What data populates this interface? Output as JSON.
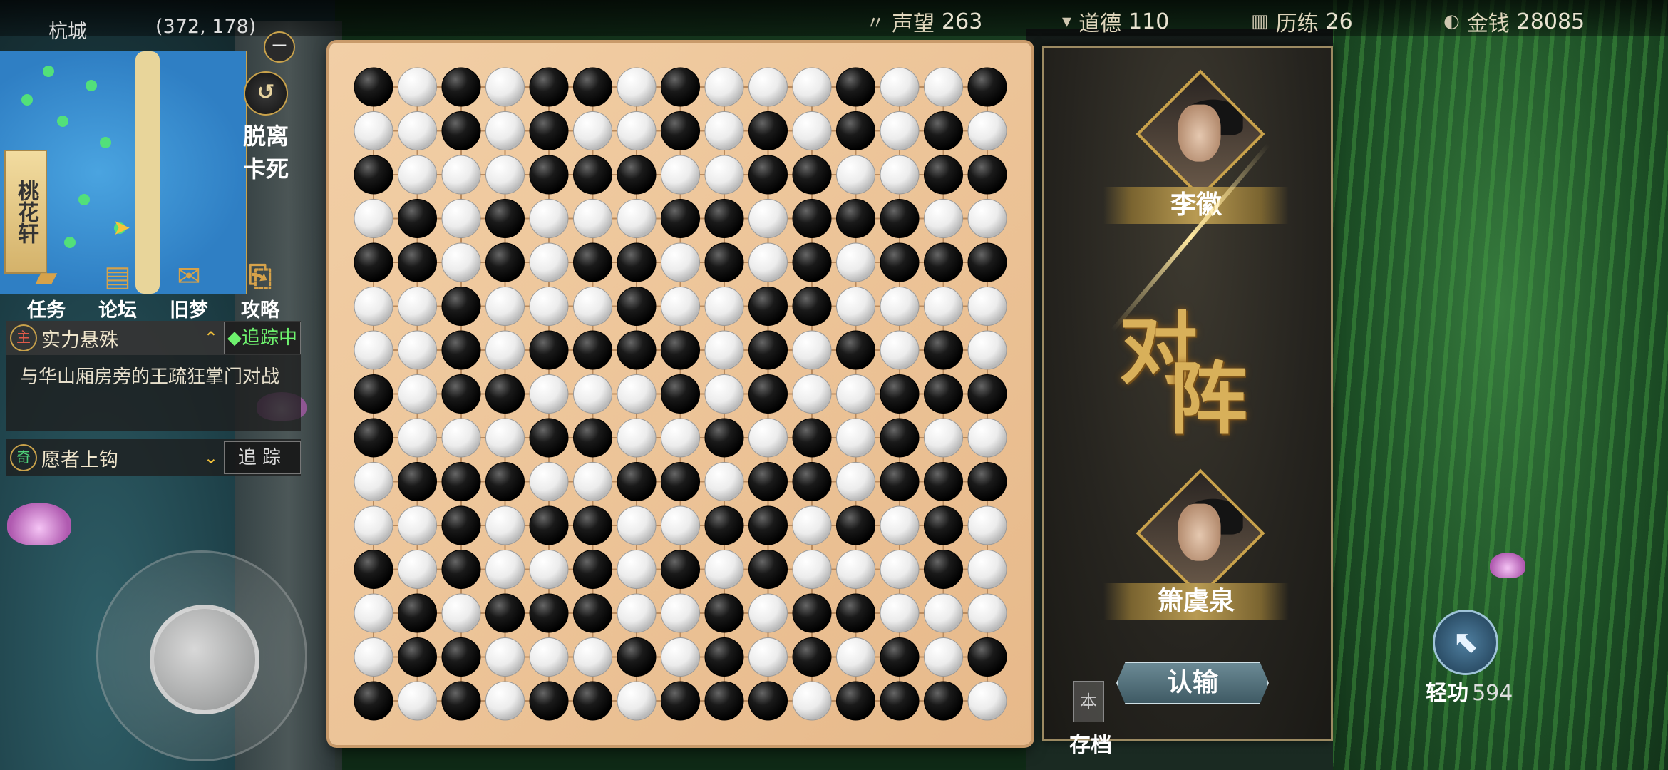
{
  "location": {
    "name": "杭城",
    "coords": "(372, 178)"
  },
  "stats": [
    {
      "label": "声望",
      "value": "263",
      "icon": "reputation-icon"
    },
    {
      "label": "道德",
      "value": "110",
      "icon": "morality-icon"
    },
    {
      "label": "历练",
      "value": "26",
      "icon": "experience-icon"
    },
    {
      "label": "金钱",
      "value": "28085",
      "icon": "money-icon"
    }
  ],
  "minimap": {
    "area_label": "桃花轩",
    "collapse_symbol": "−"
  },
  "unstuck": {
    "label_line1": "脱离",
    "label_line2": "卡死"
  },
  "menu": [
    {
      "label": "任务",
      "icon": "quest-icon"
    },
    {
      "label": "论坛",
      "icon": "forum-icon"
    },
    {
      "label": "旧梦",
      "icon": "memory-icon"
    },
    {
      "label": "攻略",
      "icon": "guide-icon"
    }
  ],
  "quests": {
    "main": {
      "tag": "主",
      "title": "实力悬殊",
      "track_label": "◆追踪中",
      "description": "与华山厢房旁的王疏狂掌门对战"
    },
    "side": {
      "tag": "奇",
      "title": "愿者上钩",
      "track_label": "追踪"
    }
  },
  "board": {
    "size": 15,
    "rows": [
      "BWBWBBWBWWWBWWB",
      "WWBWBWWBWBWBWBW",
      "BWWWBBBWWBBWWBB",
      "WBWBWWWBBWBBBWW",
      "BBWBWBBWBWBWBBB",
      "WWBWWWBWWBBWWWW",
      "WWBWBBBBWBWBWBW",
      "BWBBWWWBWBWWBBB",
      "BWWWBBWWBWBWBWW",
      "WBBBWWBBWBBWBBB",
      "WWBWBBWWBBWBWBW",
      "BWBWWBWBWBWWWBW",
      "WBWBBBWWBWBBWWW",
      "WBBWWWBWBWBWBWB",
      "BWBWBBWBBBWBBBW"
    ]
  },
  "match": {
    "player1": "李徽",
    "player2": "箫虞泉",
    "vs_char1": "对",
    "vs_char2": "阵",
    "resign_label": "认输",
    "save_label": "存档",
    "save_icon_char": "本"
  },
  "lightness_skill": {
    "label": "轻功",
    "value": "594"
  },
  "colors": {
    "accent_gold": "#c9a24b",
    "tracking_green": "#6ef26e",
    "board": "#efc79c"
  }
}
